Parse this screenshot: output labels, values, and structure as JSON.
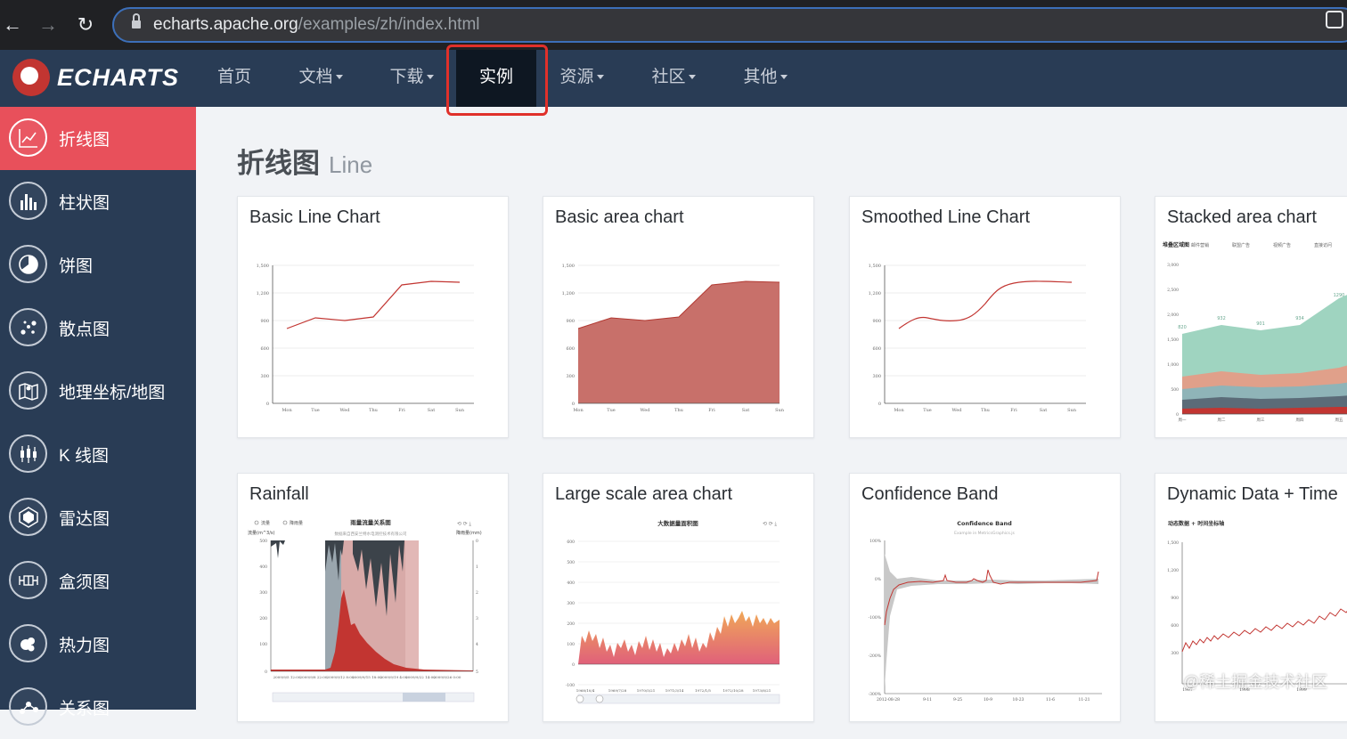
{
  "browser": {
    "url_host": "echarts.apache.org",
    "url_path": "/examples/zh/index.html"
  },
  "topnav": {
    "logo_text": "ECHARTS",
    "items": [
      {
        "label": "首页",
        "dropdown": false
      },
      {
        "label": "文档",
        "dropdown": true
      },
      {
        "label": "下载",
        "dropdown": true
      },
      {
        "label": "实例",
        "dropdown": false,
        "active": true
      },
      {
        "label": "资源",
        "dropdown": true
      },
      {
        "label": "社区",
        "dropdown": true
      },
      {
        "label": "其他",
        "dropdown": true
      }
    ]
  },
  "sidebar": {
    "items": [
      {
        "label": "折线图",
        "icon": "line-chart-icon",
        "active": true
      },
      {
        "label": "柱状图",
        "icon": "bar-chart-icon"
      },
      {
        "label": "饼图",
        "icon": "pie-chart-icon"
      },
      {
        "label": "散点图",
        "icon": "scatter-chart-icon"
      },
      {
        "label": "地理坐标/地图",
        "icon": "map-icon"
      },
      {
        "label": "K 线图",
        "icon": "candlestick-icon"
      },
      {
        "label": "雷达图",
        "icon": "radar-icon"
      },
      {
        "label": "盒须图",
        "icon": "boxplot-icon"
      },
      {
        "label": "热力图",
        "icon": "heatmap-icon"
      },
      {
        "label": "关系图",
        "icon": "graph-icon"
      }
    ]
  },
  "page": {
    "title_zh": "折线图",
    "title_en": "Line"
  },
  "cards": [
    {
      "title": "Basic Line Chart"
    },
    {
      "title": "Basic area chart"
    },
    {
      "title": "Smoothed Line Chart"
    },
    {
      "title": "Stacked area chart"
    },
    {
      "title": "Rainfall"
    },
    {
      "title": "Large scale area chart"
    },
    {
      "title": "Confidence Band"
    },
    {
      "title": "Dynamic Data + Time"
    }
  ],
  "thumb_text": {
    "week": [
      "Mon",
      "Tue",
      "Wed",
      "Thu",
      "Fri",
      "Sat",
      "Sun"
    ],
    "y_ticks_1500": [
      "1,500",
      "1,200",
      "900",
      "600",
      "300",
      "0"
    ],
    "stacked_title": "堆叠区域图",
    "stacked_legend": [
      "邮件营销",
      "联盟广告",
      "视频广告",
      "直接访问"
    ],
    "stacked_y": [
      "3,000",
      "2,500",
      "2,000",
      "1,500",
      "1,000",
      "500",
      "0"
    ],
    "stacked_x": [
      "周一",
      "周二",
      "周三",
      "周四",
      "周五"
    ],
    "stacked_labels": [
      "820",
      "932",
      "901",
      "934",
      "1290"
    ],
    "rain_legend": [
      "流量",
      "降雨量"
    ],
    "rain_title": "雨量流量关系图",
    "rain_subtitle": "数据来自西安兰特水电测控技术有限公司",
    "rain_y_left": "流量(m^3/s)",
    "rain_y_right": "降雨量(mm)",
    "rain_left_ticks": [
      "500",
      "400",
      "300",
      "200",
      "100",
      "0"
    ],
    "rain_right_ticks": [
      "0",
      "1",
      "2",
      "3",
      "4",
      "5"
    ],
    "rain_x": [
      "2009/9/5 12:00",
      "2009/9/8 22:00",
      "2009/9/12 8:00",
      "2009/9/15 18:00",
      "2009/9/19 4:00",
      "2009/9/22 14:00",
      "2009/9/26 0:00"
    ],
    "large_title": "大数据量面积图",
    "large_y": [
      "600",
      "500",
      "400",
      "300",
      "200",
      "100",
      "0",
      "-100"
    ],
    "large_x": [
      "1968/10/4",
      "1969/7/28",
      "1970/5/21",
      "1971/3/14",
      "1972/1/5",
      "1972/10/28",
      "1973/8/21"
    ],
    "band_title": "Confidence Band",
    "band_subtitle": "Example in MetricsGraphics.js",
    "band_y": [
      "100%",
      "0%",
      "-100%",
      "-200%",
      "-300%"
    ],
    "band_x": [
      "2012-08-28",
      "9-11",
      "9-25",
      "10-9",
      "10-23",
      "11-6",
      "11-21"
    ],
    "dyn_title": "动态数据 + 时间坐标轴",
    "dyn_y": [
      "1,500",
      "1,200",
      "900",
      "600",
      "300"
    ],
    "dyn_x": [
      "1997",
      "1998",
      "1999"
    ]
  },
  "watermark": "@稀土掘金技术社区",
  "colors": {
    "accent_red": "#c23531",
    "sidebar_bg": "#293c55",
    "sidebar_active": "#e8505b",
    "nav_active_bg": "#0e1722",
    "highlight_border": "#e0302a",
    "stack_green": "#9fd4c0",
    "stack_orange": "#e0a08a",
    "stack_teal": "#8fb4b8",
    "stack_gray": "#5b6b78",
    "stack_navy": "#2f4554",
    "area_fill": "#c8706a",
    "large_top": "#f0a858",
    "large_bottom": "#e0607a"
  }
}
